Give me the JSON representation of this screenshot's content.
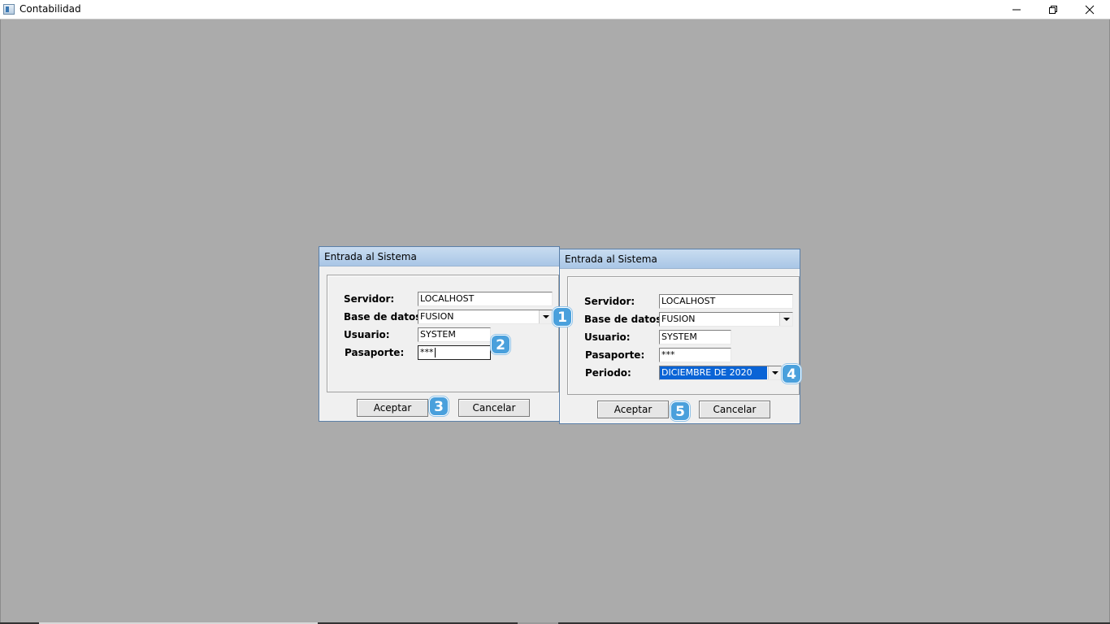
{
  "window": {
    "title": "Contabilidad",
    "controls": {
      "minimize": "minimize-icon",
      "restore": "restore-icon",
      "close": "close-icon"
    }
  },
  "login_dialog_1": {
    "title": "Entrada al Sistema",
    "fields": {
      "servidor_label": "Servidor:",
      "servidor_value": "LOCALHOST",
      "base_label": "Base de datos:",
      "base_value": "FUSION",
      "usuario_label": "Usuario:",
      "usuario_value": "SYSTEM",
      "pasaporte_label": "Pasaporte:",
      "pasaporte_value": "***"
    },
    "accept_label": "Aceptar",
    "cancel_label": "Cancelar"
  },
  "login_dialog_2": {
    "title": "Entrada al Sistema",
    "fields": {
      "servidor_label": "Servidor:",
      "servidor_value": "LOCALHOST",
      "base_label": "Base de datos:",
      "base_value": "FUSION",
      "usuario_label": "Usuario:",
      "usuario_value": "SYSTEM",
      "pasaporte_label": "Pasaporte:",
      "pasaporte_value": "***",
      "periodo_label": "Periodo:",
      "periodo_value": "DICIEMBRE DE 2020"
    },
    "accept_label": "Aceptar",
    "cancel_label": "Cancelar"
  },
  "step_badges": [
    "1",
    "2",
    "3",
    "4",
    "5"
  ],
  "colors": {
    "workspace": "#ababab",
    "badge": "#4aa0dc",
    "selection": "#0a64d6",
    "dialog_title_gradient": [
      "#c9dcf0",
      "#a9c6e6"
    ]
  }
}
